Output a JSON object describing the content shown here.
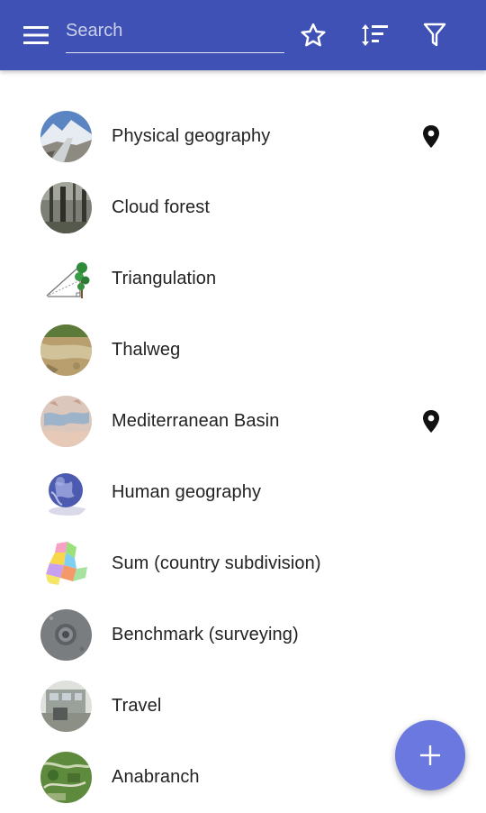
{
  "toolbar": {
    "menu_icon": "menu-icon",
    "search_placeholder": "Search",
    "search_value": "",
    "favorites_icon": "star-outline-icon",
    "sort_icon": "sort-icon",
    "filter_icon": "filter-icon",
    "color": "#3f51b5"
  },
  "items": [
    {
      "label": "Physical geography",
      "thumb": "glacier-photo",
      "has_location": true
    },
    {
      "label": "Cloud forest",
      "thumb": "forest-photo",
      "has_location": false
    },
    {
      "label": "Triangulation",
      "thumb": "triangulation-diagram",
      "has_location": false
    },
    {
      "label": "Thalweg",
      "thumb": "riverbed-photo",
      "has_location": false
    },
    {
      "label": "Mediterranean Basin",
      "thumb": "basin-map",
      "has_location": true
    },
    {
      "label": "Human geography",
      "thumb": "globe-icon",
      "has_location": false
    },
    {
      "label": "Sum (country subdivision)",
      "thumb": "subdivision-map",
      "has_location": false
    },
    {
      "label": "Benchmark (surveying)",
      "thumb": "benchmark-photo",
      "has_location": false
    },
    {
      "label": "Travel",
      "thumb": "travel-photo",
      "has_location": false
    },
    {
      "label": "Anabranch",
      "thumb": "aerial-photo",
      "has_location": false
    }
  ],
  "location_icon": "map-pin-icon",
  "fab": {
    "icon": "plus-icon",
    "color": "#6a78df"
  }
}
